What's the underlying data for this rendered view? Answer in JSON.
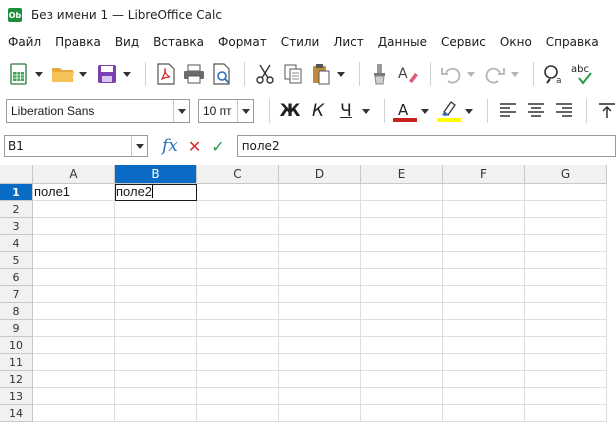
{
  "window": {
    "title": "Без имени 1 — LibreOffice Calc",
    "app_icon_text": "Ob"
  },
  "menu": [
    "Файл",
    "Правка",
    "Вид",
    "Вставка",
    "Формат",
    "Стили",
    "Лист",
    "Данные",
    "Сервис",
    "Окно",
    "Справка"
  ],
  "format_toolbar": {
    "font_name": "Liberation Sans",
    "font_size": "10 пт",
    "bold_label": "Ж",
    "italic_label": "К",
    "underline_label": "Ч",
    "font_color_letter": "A",
    "font_color": "#c9211e",
    "highlight_color": "#ffff00"
  },
  "standard_toolbar": {
    "spelling_label": "abc"
  },
  "formula_bar": {
    "name_box": "B1",
    "content": "поле2"
  },
  "sheet": {
    "columns": [
      "A",
      "B",
      "C",
      "D",
      "E",
      "F",
      "G"
    ],
    "active_column": "B",
    "rows": [
      "1",
      "2",
      "3",
      "4",
      "5",
      "6",
      "7",
      "8",
      "9",
      "10",
      "11",
      "12",
      "13",
      "14"
    ],
    "active_row": "1",
    "cells": {
      "A1": "поле1",
      "B1": "поле2"
    },
    "selected_cell": "B1"
  },
  "colors": {
    "accent": "#0a6bc5",
    "app_icon": "#1e8f3a"
  }
}
